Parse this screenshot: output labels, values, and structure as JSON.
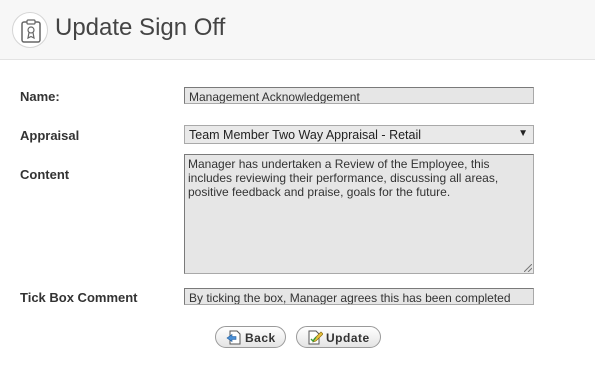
{
  "header": {
    "title": "Update Sign Off",
    "icon": "certificate-icon"
  },
  "form": {
    "name_label": "Name:",
    "name_value": "Management Acknowledgement",
    "appraisal_label": "Appraisal",
    "appraisal_value": "Team Member Two Way Appraisal - Retail",
    "content_label": "Content",
    "content_value": "Manager has undertaken a Review of the Employee, this includes reviewing their performance, discussing all areas, positive feedback and praise, goals for the future.",
    "tick_box_label": "Tick Box Comment",
    "tick_box_value": "By ticking the box, Manager agrees this has been completed"
  },
  "buttons": {
    "back_label": "Back",
    "back_icon": "back-page-icon",
    "update_label": "Update",
    "update_icon": "edit-page-icon"
  }
}
